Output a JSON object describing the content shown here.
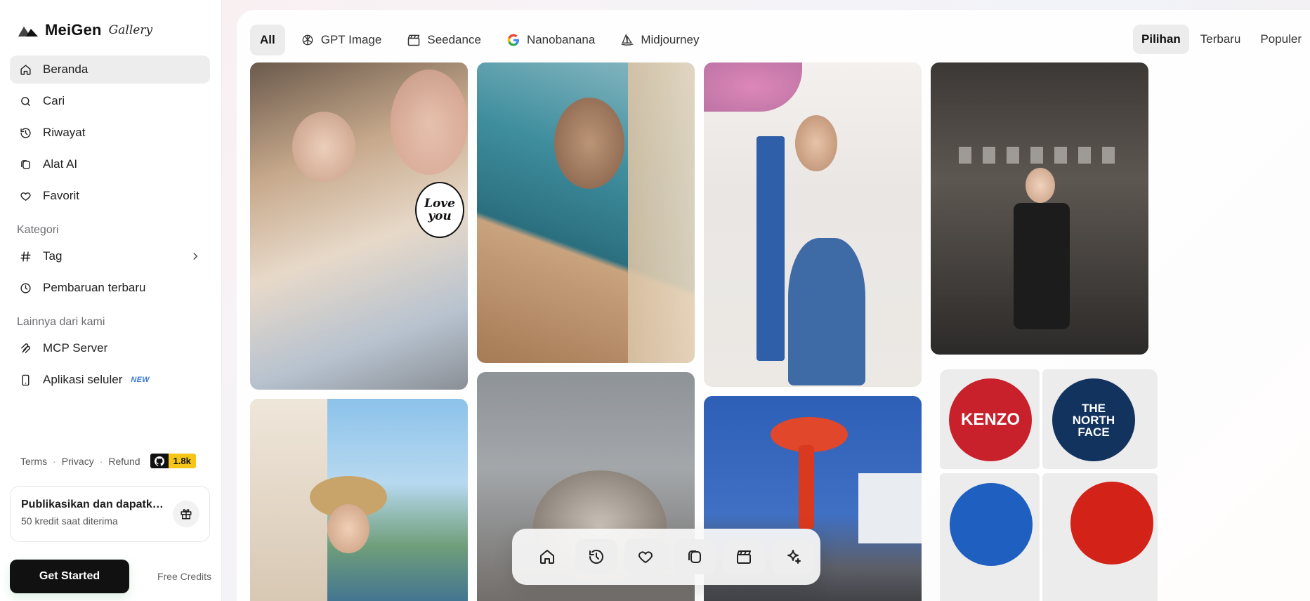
{
  "brand": {
    "name": "MeiGen",
    "sub": "Gallery"
  },
  "nav": {
    "items": [
      {
        "label": "Beranda",
        "icon": "home-icon",
        "active": true
      },
      {
        "label": "Cari",
        "icon": "search-icon"
      },
      {
        "label": "Riwayat",
        "icon": "history-icon"
      },
      {
        "label": "Alat AI",
        "icon": "ai-tools-icon"
      },
      {
        "label": "Favorit",
        "icon": "heart-icon"
      }
    ],
    "kategori_label": "Kategori",
    "kategori": [
      {
        "label": "Tag",
        "icon": "hash-icon"
      },
      {
        "label": "Pembaruan terbaru",
        "icon": "clock-icon"
      }
    ],
    "lainnya_label": "Lainnya dari kami",
    "lainnya": [
      {
        "label": "MCP Server",
        "icon": "mcp-icon"
      },
      {
        "label": "Aplikasi seluler",
        "icon": "phone-icon",
        "badge": "NEW"
      }
    ]
  },
  "footer": {
    "terms": "Terms",
    "privacy": "Privacy",
    "refund": "Refund",
    "github_stars": "1.8k"
  },
  "promo": {
    "title": "Publikasikan dan dapatkan kredit",
    "subtitle": "50 kredit saat diterima"
  },
  "cta": {
    "label": "Get Started",
    "free": "Free Credits"
  },
  "filters": [
    {
      "label": "All",
      "icon": "",
      "active": true
    },
    {
      "label": "GPT Image",
      "icon": "openai-icon"
    },
    {
      "label": "Seedance",
      "icon": "clapperboard-icon"
    },
    {
      "label": "Nanobanana",
      "icon": "google-icon"
    },
    {
      "label": "Midjourney",
      "icon": "sailboat-icon"
    }
  ],
  "sorts": [
    {
      "label": "Pilihan",
      "active": true
    },
    {
      "label": "Terbaru"
    },
    {
      "label": "Populer"
    }
  ],
  "gallery": [
    {
      "name": "card-painter-girl",
      "text": "Love you"
    },
    {
      "name": "card-pool-woman"
    },
    {
      "name": "card-white-street-woman"
    },
    {
      "name": "card-crosswalk-woman"
    },
    {
      "name": "card-straw-hat-girl"
    },
    {
      "name": "card-horse-closeup"
    },
    {
      "name": "card-red-sculpture"
    },
    {
      "name": "card-brand-stickers",
      "labels": [
        "KENZO",
        "THE NORTH FACE"
      ]
    }
  ],
  "dock": [
    "home-icon",
    "history-icon",
    "heart-icon",
    "ai-tools-icon",
    "clapperboard-icon",
    "sparkle-icon"
  ],
  "colors": {
    "accent": "#111111",
    "badge_new": "#3a7bd5",
    "github_star": "#f5c518"
  }
}
